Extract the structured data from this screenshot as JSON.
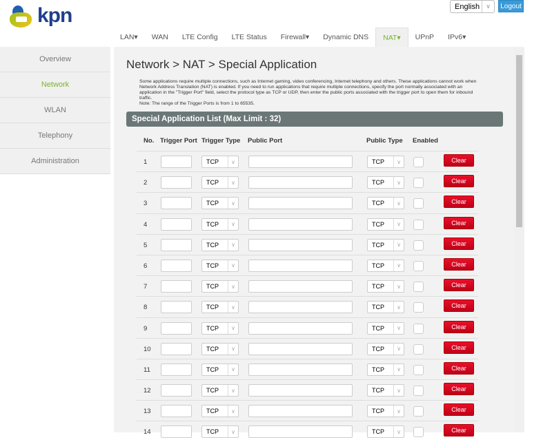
{
  "header": {
    "logo": "kpn",
    "language": "English",
    "logout": "Logout"
  },
  "nav": [
    {
      "label": "LAN▾"
    },
    {
      "label": "WAN"
    },
    {
      "label": "LTE Config"
    },
    {
      "label": "LTE Status"
    },
    {
      "label": "Firewall▾"
    },
    {
      "label": "Dynamic DNS"
    },
    {
      "label": "NAT▾",
      "active": true
    },
    {
      "label": "UPnP"
    },
    {
      "label": "IPv6▾"
    }
  ],
  "sidebar": [
    {
      "label": "Overview"
    },
    {
      "label": "Network",
      "active": true
    },
    {
      "label": "WLAN"
    },
    {
      "label": "Telephony"
    },
    {
      "label": "Administration"
    }
  ],
  "page": {
    "title": "Network > NAT > Special Application",
    "description": "Some applications require multiple connections, such as Internet gaming, video conferencing, Internet telephony and others. These applications cannot work when Network Address Translation (NAT) is enabled. If you need to run applications that require multiple connections, specify the port normally associated with an application in the \"Trigger Port\" field, select the protocol type as TCP or UDP, then enter the public ports associated with the trigger port to open them for inbound traffic.",
    "note": "Note: The range of the Trigger Ports is from 1 to 65535.",
    "list_title": "Special Application List (Max Limit : 32)"
  },
  "table": {
    "headers": {
      "no": "No.",
      "trigger_port": "Trigger Port",
      "trigger_type": "Trigger Type",
      "public_port": "Public Port",
      "public_type": "Public Type",
      "enabled": "Enabled"
    },
    "clear_label": "Clear",
    "rows": [
      {
        "no": "1",
        "trigger_type": "TCP",
        "public_type": "TCP"
      },
      {
        "no": "2",
        "trigger_type": "TCP",
        "public_type": "TCP"
      },
      {
        "no": "3",
        "trigger_type": "TCP",
        "public_type": "TCP"
      },
      {
        "no": "4",
        "trigger_type": "TCP",
        "public_type": "TCP"
      },
      {
        "no": "5",
        "trigger_type": "TCP",
        "public_type": "TCP"
      },
      {
        "no": "6",
        "trigger_type": "TCP",
        "public_type": "TCP"
      },
      {
        "no": "7",
        "trigger_type": "TCP",
        "public_type": "TCP"
      },
      {
        "no": "8",
        "trigger_type": "TCP",
        "public_type": "TCP"
      },
      {
        "no": "9",
        "trigger_type": "TCP",
        "public_type": "TCP"
      },
      {
        "no": "10",
        "trigger_type": "TCP",
        "public_type": "TCP"
      },
      {
        "no": "11",
        "trigger_type": "TCP",
        "public_type": "TCP"
      },
      {
        "no": "12",
        "trigger_type": "TCP",
        "public_type": "TCP"
      },
      {
        "no": "13",
        "trigger_type": "TCP",
        "public_type": "TCP"
      },
      {
        "no": "14",
        "trigger_type": "TCP",
        "public_type": "TCP"
      }
    ]
  }
}
